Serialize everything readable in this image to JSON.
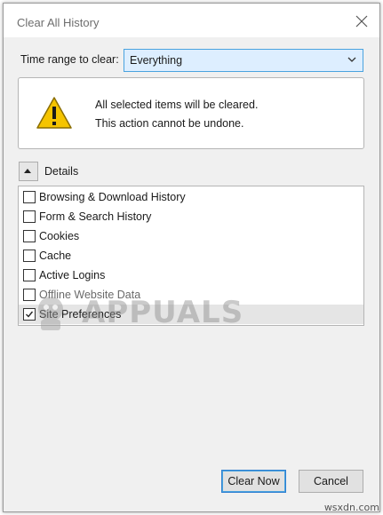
{
  "window": {
    "title": "Clear All History"
  },
  "time_range": {
    "label": "Time range to clear:",
    "selected": "Everything"
  },
  "warning": {
    "line1": "All selected items will be cleared.",
    "line2": "This action cannot be undone."
  },
  "details": {
    "label": "Details",
    "expanded": true
  },
  "items": [
    {
      "label": "Browsing & Download History",
      "checked": false
    },
    {
      "label": "Form & Search History",
      "checked": false
    },
    {
      "label": "Cookies",
      "checked": false
    },
    {
      "label": "Cache",
      "checked": false
    },
    {
      "label": "Active Logins",
      "checked": false
    },
    {
      "label": "Offline Website Data",
      "checked": false
    },
    {
      "label": "Site Preferences",
      "checked": true
    }
  ],
  "buttons": {
    "clear_now": "Clear Now",
    "cancel": "Cancel"
  },
  "watermark": "APPUALS",
  "source_mark": "wsxdn.com",
  "colors": {
    "warning_yellow": "#f5c400",
    "focus_blue": "#4aa3df",
    "dropdown_bg": "#ddeeff"
  }
}
